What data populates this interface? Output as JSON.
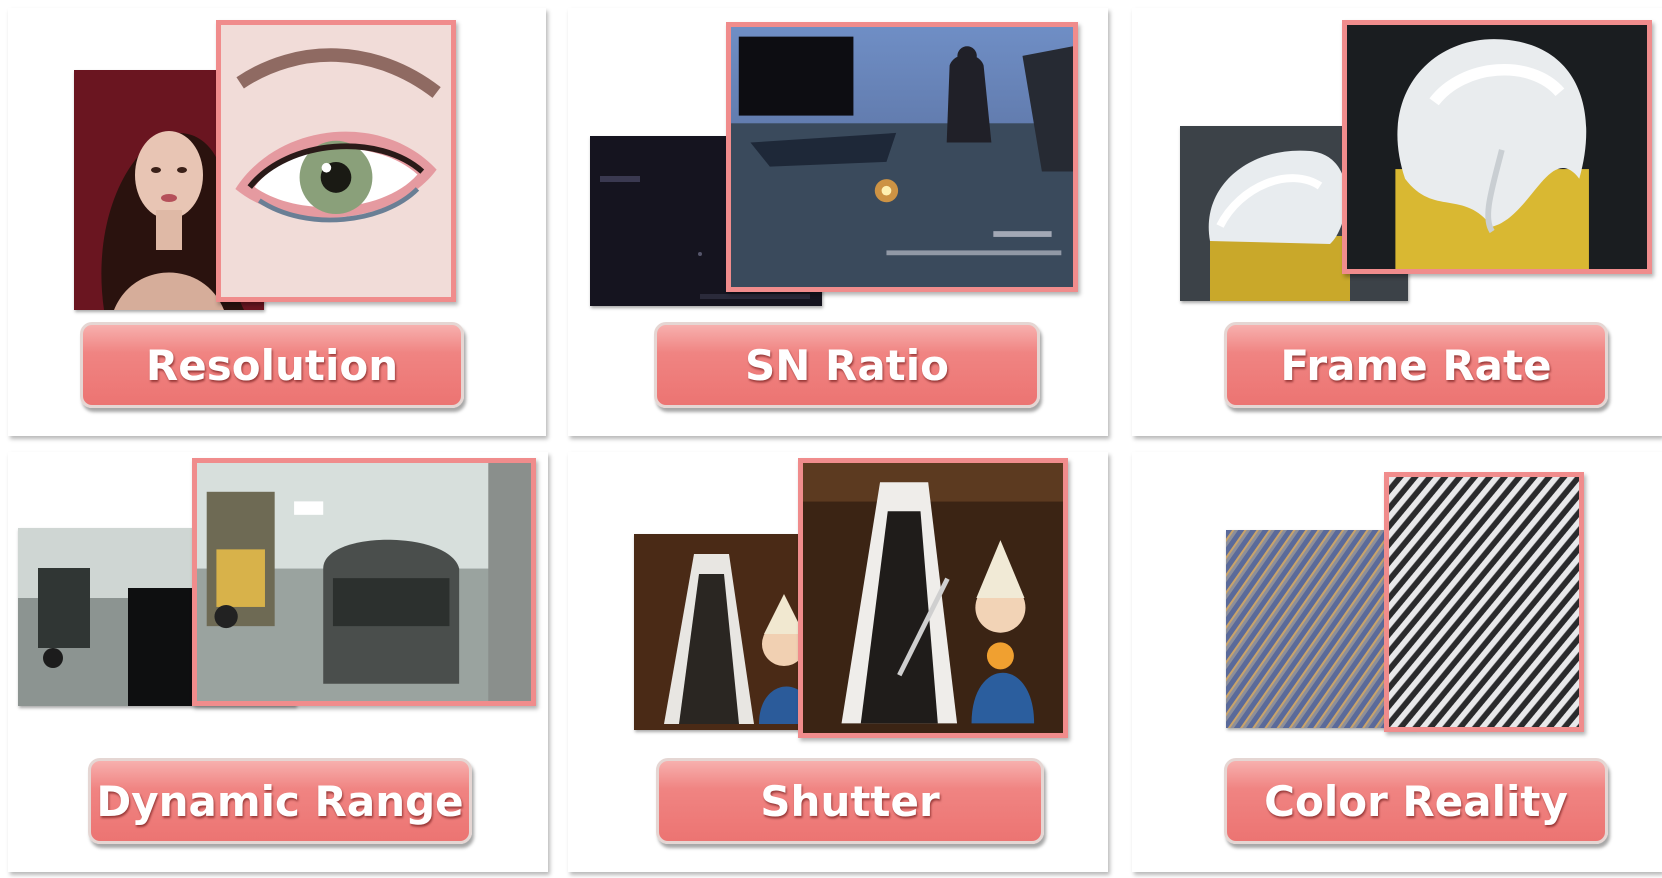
{
  "tiles": [
    {
      "label": "Resolution"
    },
    {
      "label": "SN Ratio"
    },
    {
      "label": "Frame Rate"
    },
    {
      "label": "Dynamic Range"
    },
    {
      "label": "Shutter"
    },
    {
      "label": "Color Reality"
    }
  ],
  "colors": {
    "accent": "#f08482",
    "frame_border": "#f08c8c",
    "background": "#ffffff"
  }
}
